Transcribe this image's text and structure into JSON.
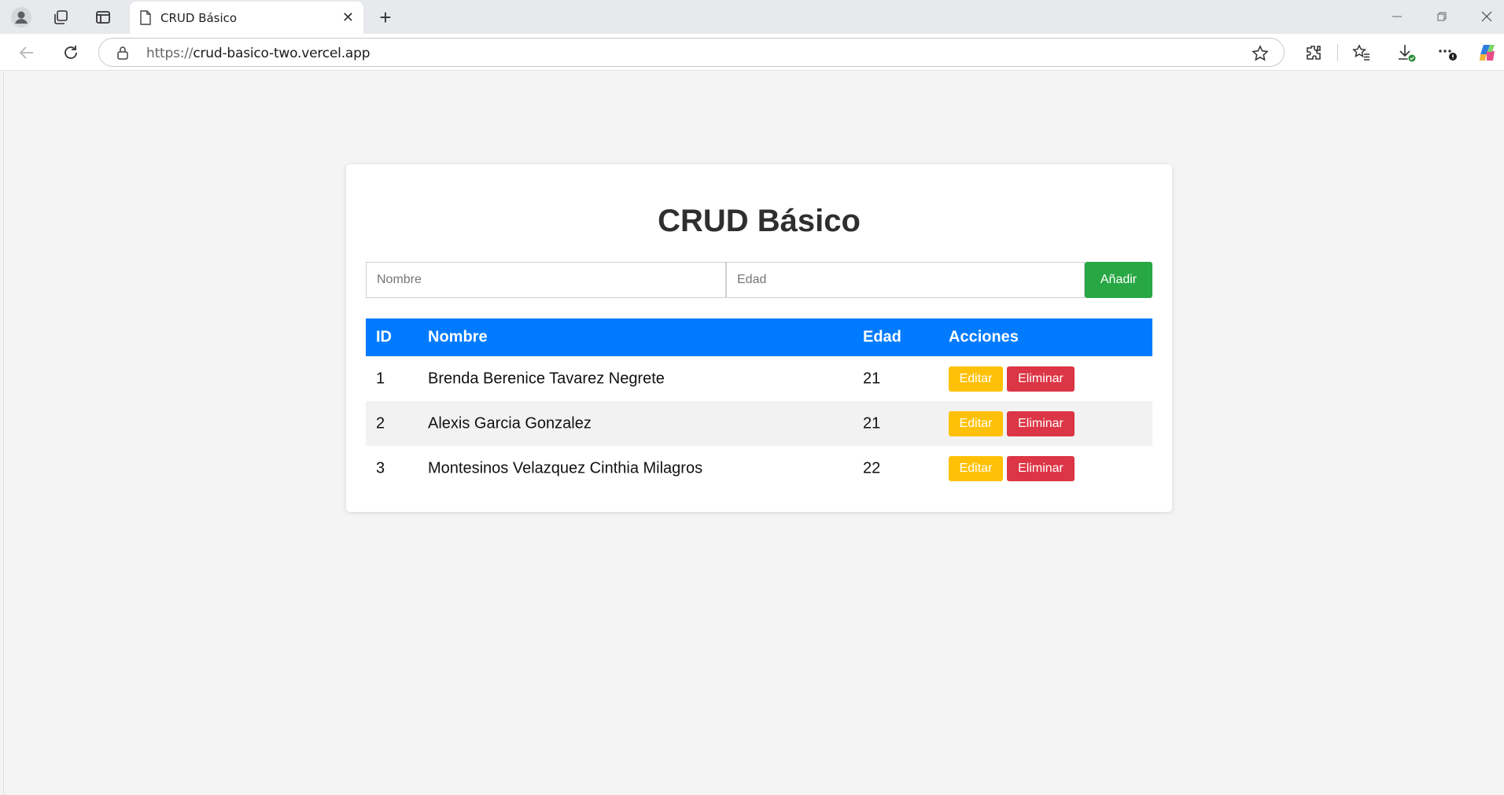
{
  "browser": {
    "tab_title": "CRUD Básico",
    "tab_close": "✕",
    "new_tab": "+",
    "url_protocol": "https://",
    "url_host": "crud-basico-two.vercel.app"
  },
  "app": {
    "title": "CRUD Básico",
    "form": {
      "name_placeholder": "Nombre",
      "age_placeholder": "Edad",
      "add_label": "Añadir"
    },
    "table": {
      "headers": {
        "id": "ID",
        "name": "Nombre",
        "age": "Edad",
        "actions": "Acciones"
      },
      "rows": [
        {
          "id": "1",
          "name": "Brenda Berenice Tavarez Negrete",
          "age": "21",
          "edit": "Editar",
          "delete": "Eliminar"
        },
        {
          "id": "2",
          "name": "Alexis Garcia Gonzalez",
          "age": "21",
          "edit": "Editar",
          "delete": "Eliminar"
        },
        {
          "id": "3",
          "name": "Montesinos Velazquez Cinthia Milagros",
          "age": "22",
          "edit": "Editar",
          "delete": "Eliminar"
        }
      ]
    }
  },
  "colors": {
    "header_blue": "#007bff",
    "add_green": "#28a745",
    "edit_yellow": "#ffc107",
    "delete_red": "#dc3545"
  },
  "icons": [
    "profile-icon",
    "workspaces-icon",
    "sidebar-icon",
    "page-icon",
    "back-icon",
    "refresh-icon",
    "lock-icon",
    "star-icon",
    "extensions-icon",
    "favorites-icon",
    "downloads-icon",
    "more-icon",
    "copilot-icon"
  ]
}
